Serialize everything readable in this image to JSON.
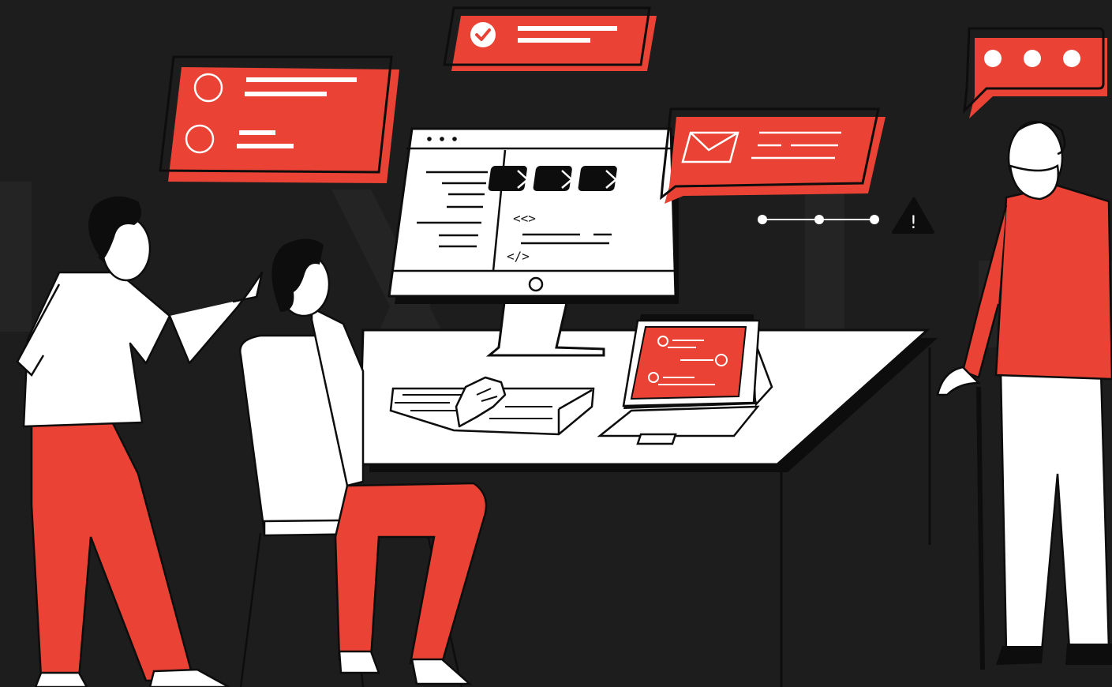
{
  "colors": {
    "background": "#1d1d1d",
    "accent": "#ea4335",
    "ink": "#0d0d0d",
    "paper": "#ffffff"
  },
  "monitor": {
    "window_dots_icon": "three-dots-icon",
    "close_tiles": [
      "close-x-icon",
      "close-x-icon",
      "close-x-icon"
    ],
    "code_open": "<<>",
    "code_close": "</>"
  },
  "popups": {
    "checklist_card_icon": "radio-circle-icon",
    "task_card_icon": "check-circle-icon",
    "mail_card_icon": "envelope-icon",
    "chat_bubble_icon": "ellipsis-icon"
  },
  "progress": {
    "steps": 3,
    "alert_icon": "warning-triangle-icon",
    "alert_glyph": "!"
  }
}
